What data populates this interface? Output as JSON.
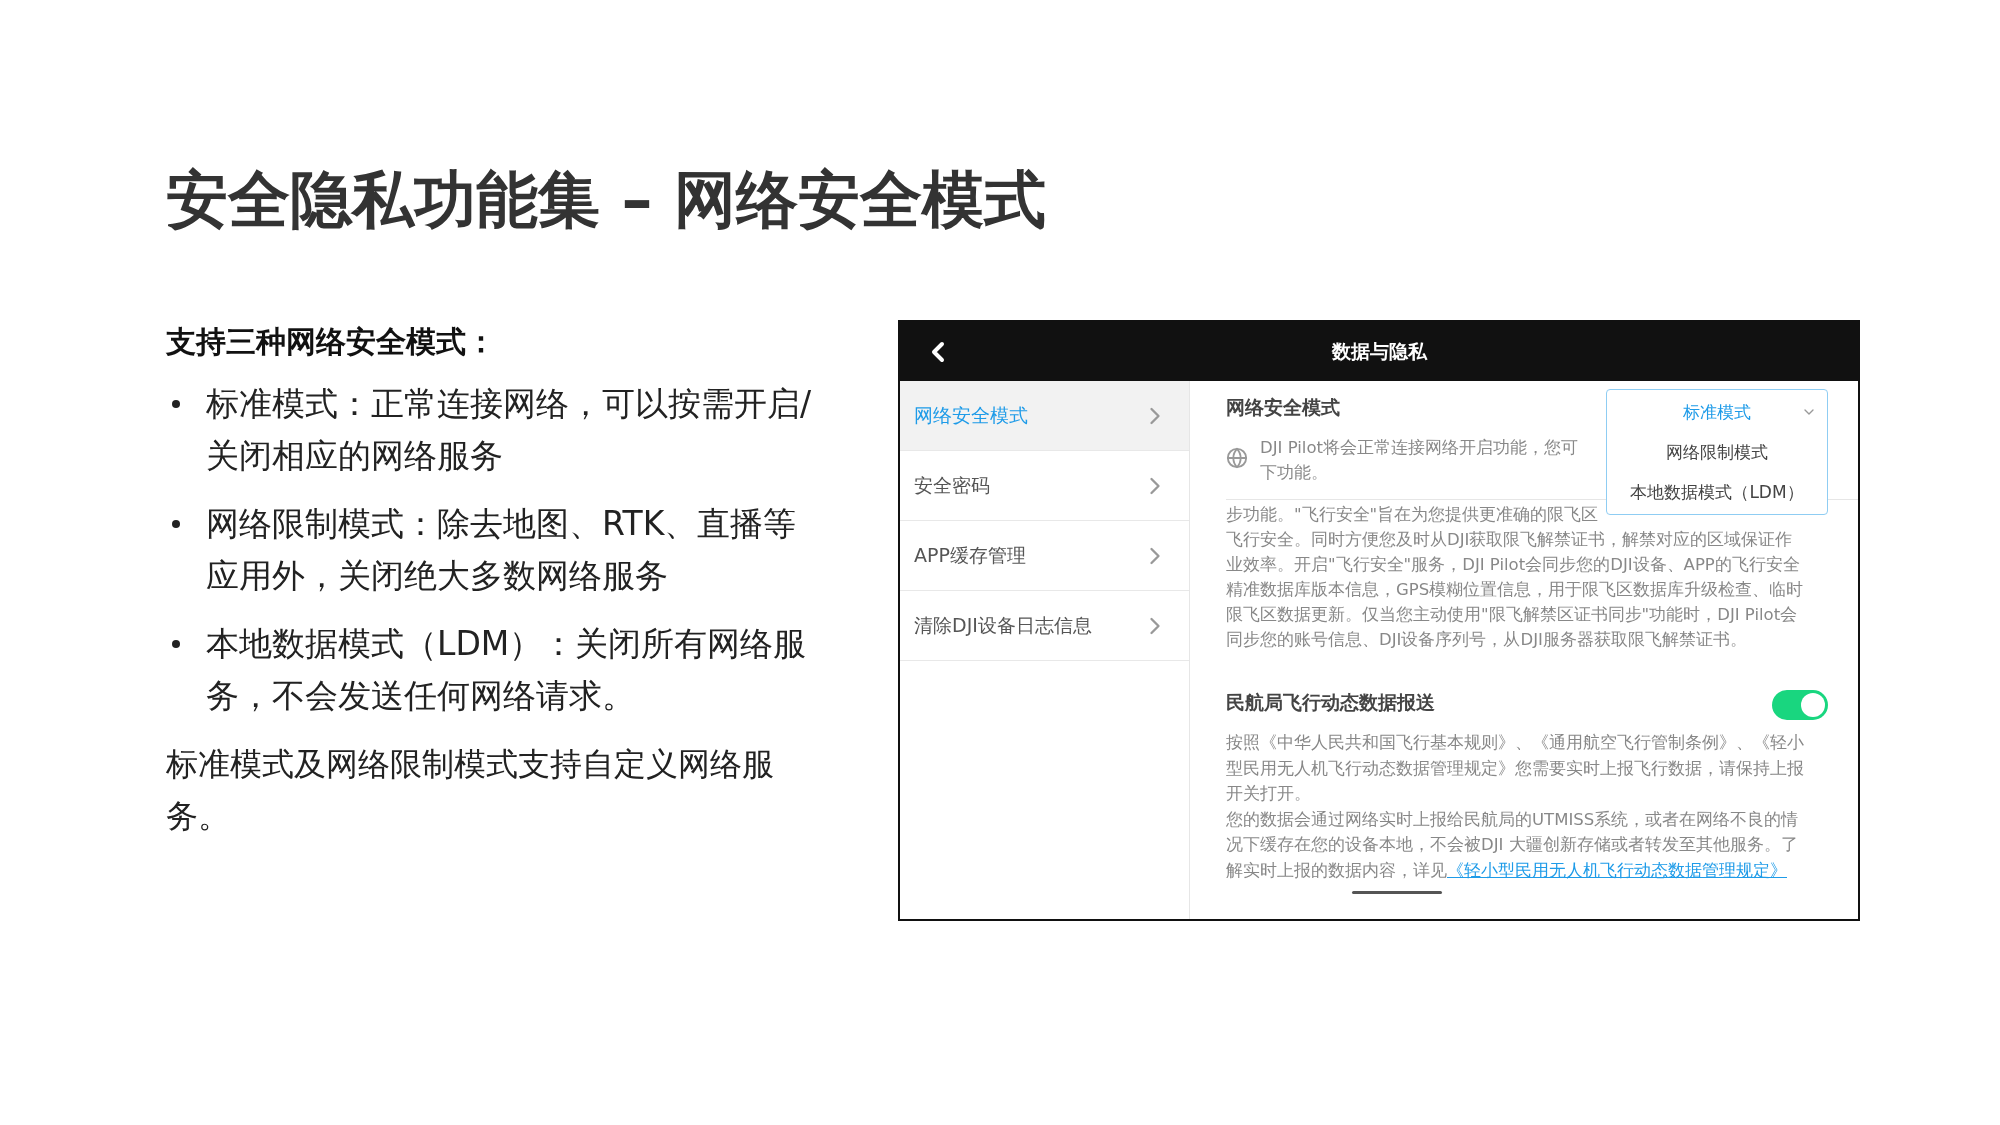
{
  "slide": {
    "title": "安全隐私功能集 – 网络安全模式",
    "heading": "支持三种网络安全模式：",
    "bullets": [
      "标准模式：正常连接网络，可以按需开启/关闭相应的网络服务",
      "网络限制模式：除去地图、RTK、直播等应用外，关闭绝大多数网络服务",
      "本地数据模式（LDM）：关闭所有网络服务，不会发送任何网络请求。"
    ],
    "note": "标准模式及网络限制模式支持自定义网络服务。"
  },
  "app": {
    "title": "数据与隐私",
    "sidebar": [
      {
        "label": "网络安全模式",
        "selected": true
      },
      {
        "label": "安全密码",
        "selected": false
      },
      {
        "label": "APP缓存管理",
        "selected": false
      },
      {
        "label": "清除DJI设备日志信息",
        "selected": false
      }
    ],
    "network_mode": {
      "title": "网络安全模式",
      "description_lines": [
        "DJI Pilot将会正常连接网络开启功能，您可",
        "下功能。"
      ],
      "dropdown": {
        "options": [
          {
            "label": "标准模式",
            "selected": true
          },
          {
            "label": "网络限制模式",
            "selected": false
          },
          {
            "label": "本地数据模式（LDM）",
            "selected": false
          }
        ]
      },
      "paragraph_lines": [
        "步功能。\"飞行安全\"旨在为您提供更准确的限飞区",
        "飞行安全。同时方便您及时从DJI获取限飞解禁证书，解禁对应的区域保证作",
        "业效率。开启\"飞行安全\"服务，DJI Pilot会同步您的DJI设备、APP的飞行安全",
        "精准数据库版本信息，GPS模糊位置信息，用于限飞区数据库升级检查、临时",
        "限飞区数据更新。仅当您主动使用\"限飞解禁区证书同步\"功能时，DJI Pilot会",
        "同步您的账号信息、DJI设备序列号，从DJI服务器获取限飞解禁证书。"
      ]
    },
    "caac_report": {
      "title": "民航局飞行动态数据报送",
      "on": true,
      "paragraphs": [
        "按照《中华人民共和国飞行基本规则》、《通用航空飞行管制条例》、《轻小型民用无人机飞行动态数据管理规定》您需要实时上报飞行数据，请保持上报开关打开。"
      ],
      "last_paragraph": "您的数据会通过网络实时上报给民航局的UTMISS系统，或者在网络不良的情况下缓存在您的设备本地，不会被DJI 大疆创新存储或者转发至其他服务。了解实时上报的数据内容，详见",
      "link": "《轻小型民用无人机飞行动态数据管理规定》"
    }
  }
}
